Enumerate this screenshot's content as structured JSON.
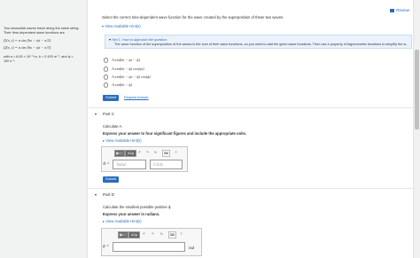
{
  "review_label": "Review",
  "problem": {
    "intro": "Two sinusoidal waves travel along the same string. Their time-dependent wave functions are",
    "eq1": "f1(x, t) = a sin (bx − ψt − π/2)",
    "eq2": "f2(x, t) = a sin (bx − ψt − π/3)",
    "values": "with a = 6.00 × 10⁻³ m, b = 0.100 m⁻¹, and ψ = 100 s⁻¹."
  },
  "part_b": {
    "instruction": "Select the correct time-dependent wave function for the wave created by the superposition of these two waves.",
    "hint_link": "View Available Hint(s)",
    "hint_title": "Hint 1. How to approach the question",
    "hint_body": "The wave function of the superposition of the waves is the sum of their wave functions, so you need to add the given wave functions. Then use a property of trigonometric functions to simplify the sum.",
    "options": [
      "A sin(bx − ψt − ϕ)",
      "A sin(bx − ϕ) cos(ψt)",
      "A sin(bx − ψt − ϕ) cos(ϕ)",
      "A sin(bx − ϕ)"
    ],
    "submit": "Submit",
    "request": "Request Answer"
  },
  "part_c": {
    "title": "Part C",
    "task": "Calculate A.",
    "instruction": "Express your answer to four significant figures and include the appropriate units.",
    "hint_link": "View Available Hint(s)",
    "label": "A =",
    "value_placeholder": "Value",
    "units_placeholder": "Units",
    "submit": "Submit"
  },
  "part_d": {
    "title": "Part D",
    "task": "Calculate the smallest possible positive ϕ.",
    "instruction": "Express your answer in radians.",
    "hint_link": "View Available Hint(s)",
    "label": "ϕ =",
    "unit": "rad"
  },
  "toolbar": {
    "templates": "▦√▢",
    "greek": "ΑΣφ",
    "undo": "↶",
    "redo": "↷",
    "reset": "↻",
    "keyboard": "⌨",
    "help": "?",
    "units": "μA"
  }
}
